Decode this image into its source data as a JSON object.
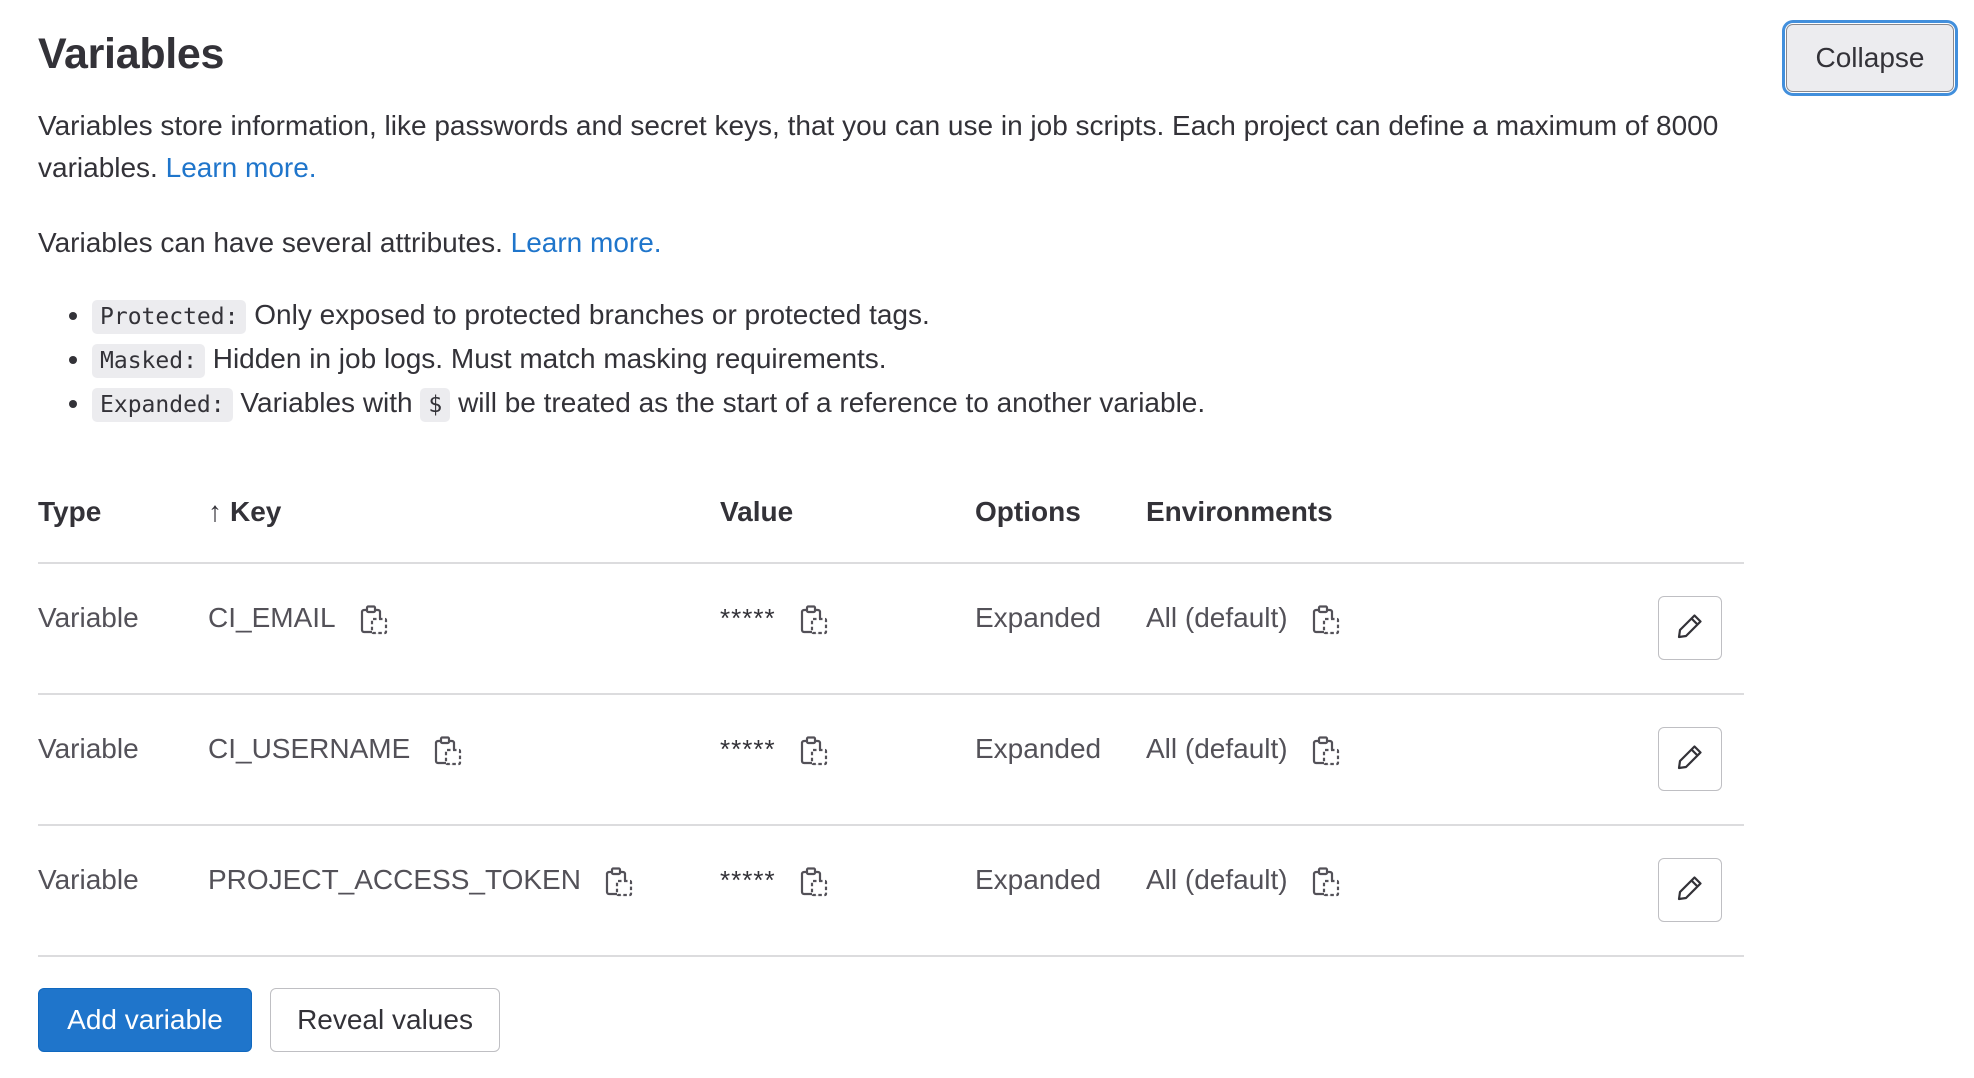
{
  "header": {
    "title": "Variables",
    "collapse_label": "Collapse"
  },
  "description": {
    "intro_text": "Variables store information, like passwords and secret keys, that you can use in job scripts. Each project can define a maximum of 8000 variables.",
    "intro_link": "Learn more.",
    "attrs_text": "Variables can have several attributes.",
    "attrs_link": "Learn more."
  },
  "attributes": [
    {
      "code": "Protected:",
      "text": "Only exposed to protected branches or protected tags."
    },
    {
      "code": "Masked:",
      "text": "Hidden in job logs. Must match masking requirements."
    },
    {
      "code": "Expanded:",
      "text_before": "Variables with",
      "inline_code": "$",
      "text_after": "will be treated as the start of a reference to another variable."
    }
  ],
  "table": {
    "columns": {
      "type": "Type",
      "key_arrow": "↑",
      "key": "Key",
      "value": "Value",
      "options": "Options",
      "environments": "Environments"
    },
    "rows": [
      {
        "type": "Variable",
        "key": "CI_EMAIL",
        "value": "*****",
        "options": "Expanded",
        "environment": "All (default)"
      },
      {
        "type": "Variable",
        "key": "CI_USERNAME",
        "value": "*****",
        "options": "Expanded",
        "environment": "All (default)"
      },
      {
        "type": "Variable",
        "key": "PROJECT_ACCESS_TOKEN",
        "value": "*****",
        "options": "Expanded",
        "environment": "All (default)"
      }
    ]
  },
  "actions": {
    "add_label": "Add variable",
    "reveal_label": "Reveal values"
  },
  "icons": {
    "copy": "copy-to-clipboard-icon",
    "edit": "pencil-icon",
    "sort": "arrow-up-icon"
  },
  "colors": {
    "primary": "#1f75cb",
    "text": "#333238",
    "muted_text": "#535158",
    "border": "#dcdcde",
    "focus_ring": "#428fdc"
  }
}
